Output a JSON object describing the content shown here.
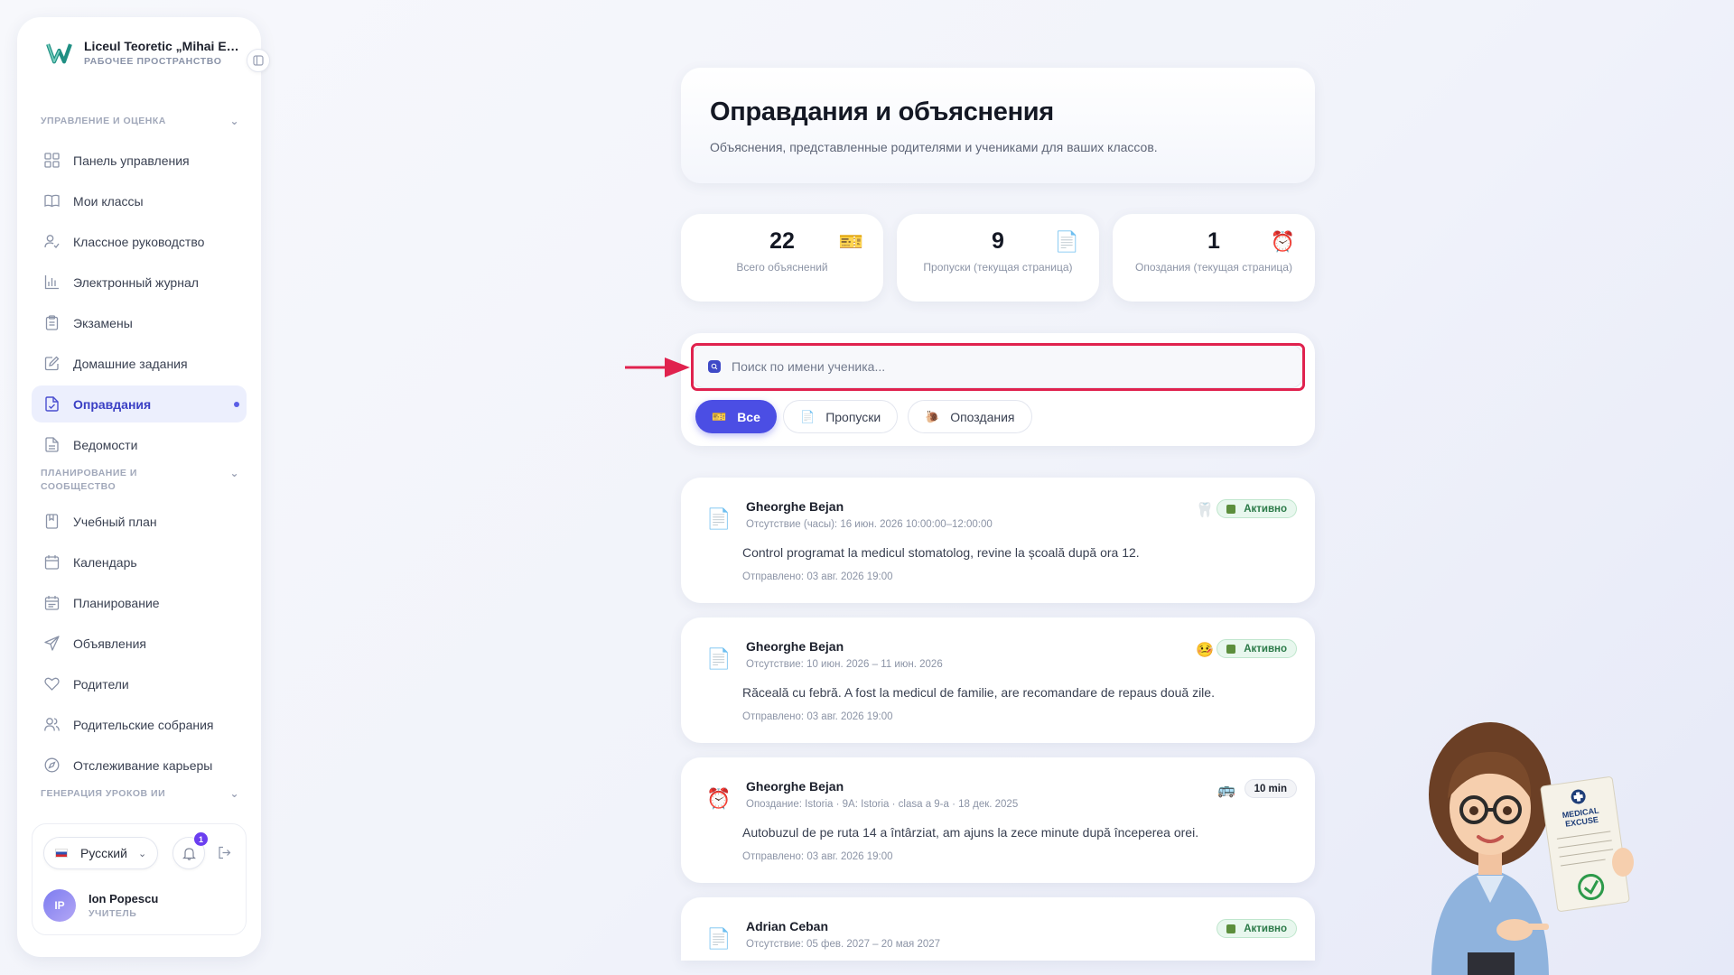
{
  "workspace": {
    "name": "Liceul Teoretic „Mihai Eminescu”",
    "subtitle": "РАБОЧЕЕ ПРОСТРАНСТВО"
  },
  "sidebar": {
    "section1": "УПРАВЛЕНИЕ И ОЦЕНКА",
    "section2": "ПЛАНИРОВАНИЕ И СООБЩЕСТВО",
    "section3": "ГЕНЕРАЦИЯ УРОКОВ ИИ",
    "items1": [
      "Панель управления",
      "Мои классы",
      "Классное руководство",
      "Электронный журнал",
      "Экзамены",
      "Домашние задания",
      "Оправдания",
      "Ведомости"
    ],
    "items2": [
      "Учебный план",
      "Календарь",
      "Планирование",
      "Объявления",
      "Родители",
      "Родительские собрания",
      "Отслеживание карьеры"
    ],
    "language": "Русский",
    "notifications": "1",
    "user": {
      "initials": "IP",
      "name": "Ion Popescu",
      "role": "УЧИТЕЛЬ"
    }
  },
  "page": {
    "title": "Оправдания и объяснения",
    "subtitle": "Объяснения, представленные родителями и учениками для ваших классов."
  },
  "stats": [
    {
      "value": "22",
      "label": "Всего объяснений"
    },
    {
      "value": "9",
      "label": "Пропуски (текущая страница)"
    },
    {
      "value": "1",
      "label": "Опоздания (текущая страница)"
    }
  ],
  "search": {
    "placeholder": "Поиск по имени ученика..."
  },
  "filters": {
    "all": "Все",
    "absences": "Пропуски",
    "lates": "Опоздания"
  },
  "excuses": [
    {
      "name": "Gheorghe Bejan",
      "meta": "Отсутствие (часы): 16 июн. 2026 10:00:00–12:00:00",
      "text": "Control programat la medicul stomatolog, revine la școală după ora 12.",
      "sent": "Отправлено: 03 авг. 2026 19:00",
      "status": "Активно",
      "reason_icon": "tooth-icon"
    },
    {
      "name": "Gheorghe Bejan",
      "meta": "Отсутствие: 10 июн. 2026 – 11 июн. 2026",
      "text": "Răceală cu febră. A fost la medicul de familie, are recomandare de repaus două zile.",
      "sent": "Отправлено: 03 авг. 2026 19:00",
      "status": "Активно",
      "reason_icon": "sick-face-icon"
    },
    {
      "name": "Gheorghe Bejan",
      "meta": "Опоздание: Istoria · 9A: Istoria · clasa a 9-a · 18 дек. 2025",
      "text": "Autobuzul de pe ruta 14 a întârziat, am ajuns la zece minute după începerea orei.",
      "sent": "Отправлено: 03 авг. 2026 19:00",
      "status": "10 min",
      "reason_icon": "bus-icon"
    },
    {
      "name": "Adrian Ceban",
      "meta": "Отсутствие: 05 фев. 2027 – 20 мая 2027",
      "text": "",
      "sent": "",
      "status": "Активно",
      "reason_icon": ""
    }
  ],
  "illustration": {
    "note_title": "MEDICAL EXCUSE"
  }
}
